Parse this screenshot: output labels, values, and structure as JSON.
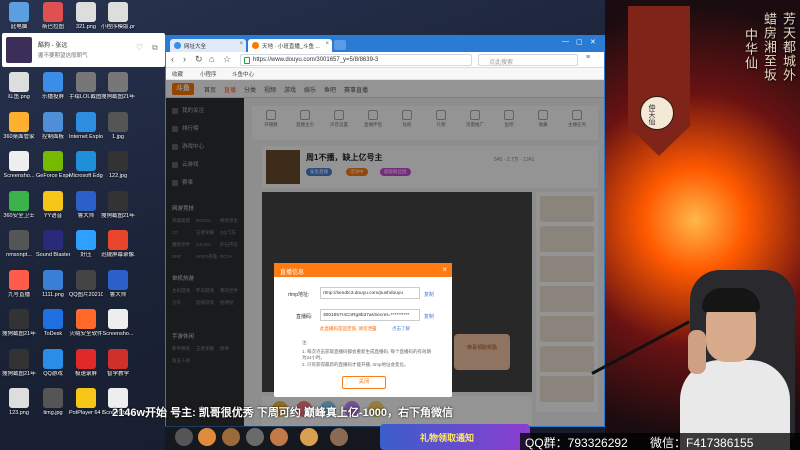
{
  "desktop": {
    "icons": [
      {
        "label": "此电脑",
        "color": "#5aa0e0"
      },
      {
        "label": "斯巴拉图",
        "color": "#e05050"
      },
      {
        "label": "321.png",
        "color": "#ddd"
      },
      {
        "label": "小程序模版.png",
        "color": "#ddd"
      },
      {
        "label": "红鱼.png",
        "color": "#ddd"
      },
      {
        "label": "乐播投屏",
        "color": "#3a8ee8"
      },
      {
        "label": "手绘LOL截图.png",
        "color": "#777"
      },
      {
        "label": "搜狗截图21年04月16...",
        "color": "#777"
      },
      {
        "label": "360桌面管家",
        "color": "#ffb02e"
      },
      {
        "label": "控制面板",
        "color": "#4f8fd8"
      },
      {
        "label": "Internet Explorer",
        "color": "#2d8de0"
      },
      {
        "label": "1.jpg",
        "color": "#555"
      },
      {
        "label": "Screensho...",
        "color": "#eee"
      },
      {
        "label": "GeForce Experience",
        "color": "#76b900"
      },
      {
        "label": "Microsoft Edge",
        "color": "#1e8fd8"
      },
      {
        "label": "122.jpg",
        "color": "#333"
      },
      {
        "label": "360安全卫士",
        "color": "#3cb34a"
      },
      {
        "label": "YY语音",
        "color": "#f5c518"
      },
      {
        "label": "鲁大师",
        "color": "#2a60c8"
      },
      {
        "label": "搜狗截图21年04月16...",
        "color": "#333"
      },
      {
        "label": "nmsonpt...",
        "color": "#555"
      },
      {
        "label": "Sound Blaster ...",
        "color": "#2a2a7a"
      },
      {
        "label": "好压",
        "color": "#2ea0ff"
      },
      {
        "label": "迅捷屏幕录像工具",
        "color": "#e8462c"
      },
      {
        "label": "九号直播",
        "color": "#ff5a4a"
      },
      {
        "label": "1111.png",
        "color": "#3a7fd6"
      },
      {
        "label": "QQ图片20210726...",
        "color": "#444"
      },
      {
        "label": "鲁大师",
        "color": "#2a60c8"
      },
      {
        "label": "搜狗截图21年04月16...",
        "color": "#333"
      },
      {
        "label": "ToDesk",
        "color": "#1e6fe0"
      },
      {
        "label": "火绒安全软件",
        "color": "#ff6a2a"
      },
      {
        "label": "Screensho...",
        "color": "#eee"
      },
      {
        "label": "搜狗截图21年04月23...",
        "color": "#333"
      },
      {
        "label": "QQ游戏",
        "color": "#2a8ee8"
      },
      {
        "label": "极速录屏",
        "color": "#e02a2a"
      },
      {
        "label": "智学教学",
        "color": "#d0302a"
      },
      {
        "label": "123.png",
        "color": "#ddd"
      },
      {
        "label": "timg.jpg",
        "color": "#555"
      },
      {
        "label": "PotPlayer 64 bit",
        "color": "#f5c518"
      },
      {
        "label": "Screensho...",
        "color": "#eee"
      }
    ],
    "notification": {
      "title": "酷狗 - 张远",
      "subtitle": "握不要期望这般朝气",
      "like_icon": "heart-icon",
      "share_icon": "share-icon"
    }
  },
  "browser": {
    "tabs": [
      {
        "label": "网址大全",
        "active": false
      },
      {
        "label": "天地 · 小班直播_斗鱼 ...",
        "active": true
      }
    ],
    "url": "https://www.douyu.com/3001657_y=5/8/8639-3",
    "search_placeholder": "点此搜索",
    "bookmarks": [
      "收藏",
      "小程序",
      "斗鱼中心"
    ],
    "site": {
      "logo": "斗鱼",
      "nav": [
        "首页",
        "直播",
        "分类",
        "视频",
        "游戏",
        "娱乐",
        "鱼吧",
        "赛事直播"
      ],
      "nav_active_index": 1,
      "sidebar": {
        "items": [
          "我的关注",
          "排行榜",
          "游戏中心",
          "云游戏",
          "赛事"
        ],
        "section_title": "网游竞技",
        "grid": [
          "英雄联盟",
          "DOTA2",
          "绝地求生",
          "CF",
          "王者荣耀",
          "QQ飞车",
          "魔兽世界",
          "CS:GO",
          "炉石传说",
          "DNF",
          "APEX英雄",
          "DOTA"
        ],
        "section_title_2": "单机热游",
        "grid_2": [
          "主机游戏",
          "怀旧游戏",
          "我的世界",
          "方舟",
          "恐怖游戏",
          "枪神纪"
        ],
        "section_title_3": "手游休闲",
        "grid_3": [
          "和平精英",
          "王者荣耀",
          "原神",
          "第五人格"
        ]
      },
      "tools": [
        {
          "label": "12",
          "caption": "开播数"
        },
        {
          "label": "直播主页",
          "caption": "直播主页"
        },
        {
          "label": "声音设置",
          "caption": "声音设置"
        },
        {
          "label": "直播伴侣",
          "caption": "直播伴侣"
        },
        {
          "label": "钻粉",
          "caption": "钻粉"
        },
        {
          "label": "礼物",
          "caption": "礼物"
        },
        {
          "label": "流量推广",
          "caption": "流量推广"
        },
        {
          "label": "鱼吧",
          "caption": "鱼吧"
        },
        {
          "label": "收藏",
          "caption": "收藏"
        },
        {
          "label": "主播任务",
          "caption": "主播任务"
        }
      ],
      "room": {
        "title": "周1不播，缺上亿号主",
        "tags": [
          "鲨鱼直播",
          "活动中",
          "超级粉丝团"
        ],
        "stats": "545 · 2.7万 · 1241"
      },
      "prize_text": "恭喜领取奖励"
    },
    "modal": {
      "title": "直播信息",
      "rtmp_label": "rtmp地址:",
      "rtmp_value": "rtmp://sendtc3.douyu.com/pushdouyu",
      "copy_label": "复制",
      "key_label": "直播码:",
      "key_value": "3001657r4CnRg8b37asSecret=**********",
      "warning": "此直播码是固定值, 请勿泄露",
      "link": "点击了解",
      "notes_title": "注:",
      "notes": [
        "1. 每次点击获取直播码都会重新生成直播码, 每个直播码的有效期为24小时。",
        "2. 只有获得最新的直播码才能开播, rtmp地址会变化。"
      ],
      "close_button": "关闭"
    }
  },
  "overlay": {
    "ticker": "2146w开始 号主: 凯哥很优秀 下周可约 巅峰真上亿-1000，右下角微信",
    "qq": "QQ群：793326292",
    "wechat": "微信：F417386155",
    "gift_banner": "礼物领取通知",
    "banner_text": "仲天仙",
    "poem": [
      "芳天都城外",
      "蜡房湘至坂",
      "中华仙"
    ]
  }
}
